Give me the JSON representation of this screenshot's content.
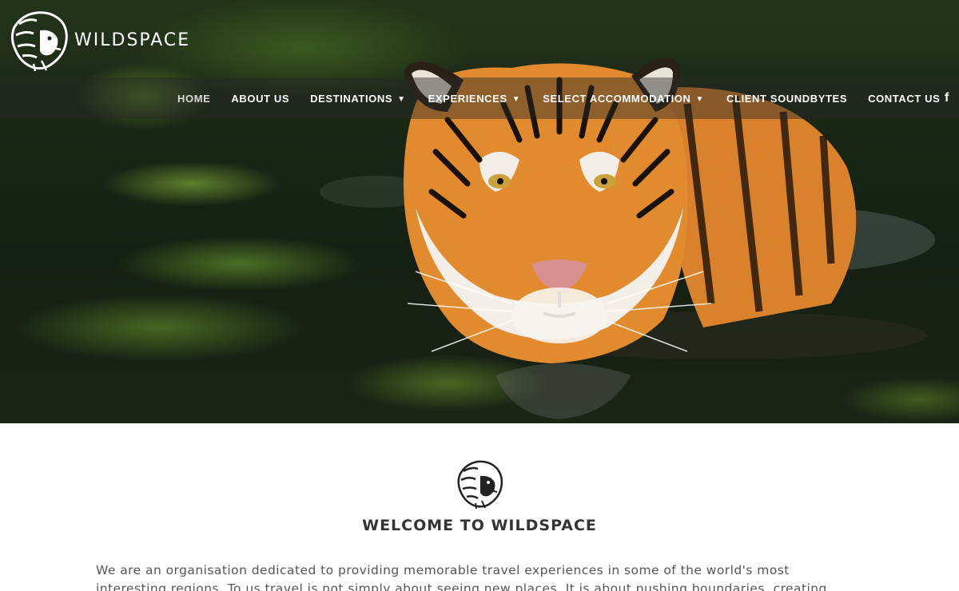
{
  "brand": {
    "name": "WILDSPACE",
    "logo_icon": "lion-head-icon"
  },
  "nav": {
    "items": [
      {
        "label": "HOME",
        "has_dropdown": false,
        "active": true
      },
      {
        "label": "ABOUT US",
        "has_dropdown": false,
        "active": false
      },
      {
        "label": "DESTINATIONS",
        "has_dropdown": true,
        "active": false
      },
      {
        "label": "EXPERIENCES",
        "has_dropdown": true,
        "active": false
      },
      {
        "label": "SELECT ACCOMMODATION",
        "has_dropdown": true,
        "active": false
      },
      {
        "label": "CLIENT SOUNDBYTES",
        "has_dropdown": false,
        "active": false
      },
      {
        "label": "CONTACT US",
        "has_dropdown": false,
        "active": false
      }
    ],
    "social_icon": "facebook-icon",
    "social_glyph": "f"
  },
  "hero": {
    "image": "tiger-swimming-in-water"
  },
  "welcome": {
    "title": "WELCOME TO WILDSPACE",
    "paragraph": "We are an organisation dedicated to providing memorable travel experiences in some of the world's most interesting regions. To us travel is not simply about seeing new places. It is about pushing boundaries, creating conversations"
  },
  "colors": {
    "nav_text": "#ffffff",
    "nav_active": "#d9d9d9",
    "heading": "#333333",
    "body_text": "#555555"
  }
}
